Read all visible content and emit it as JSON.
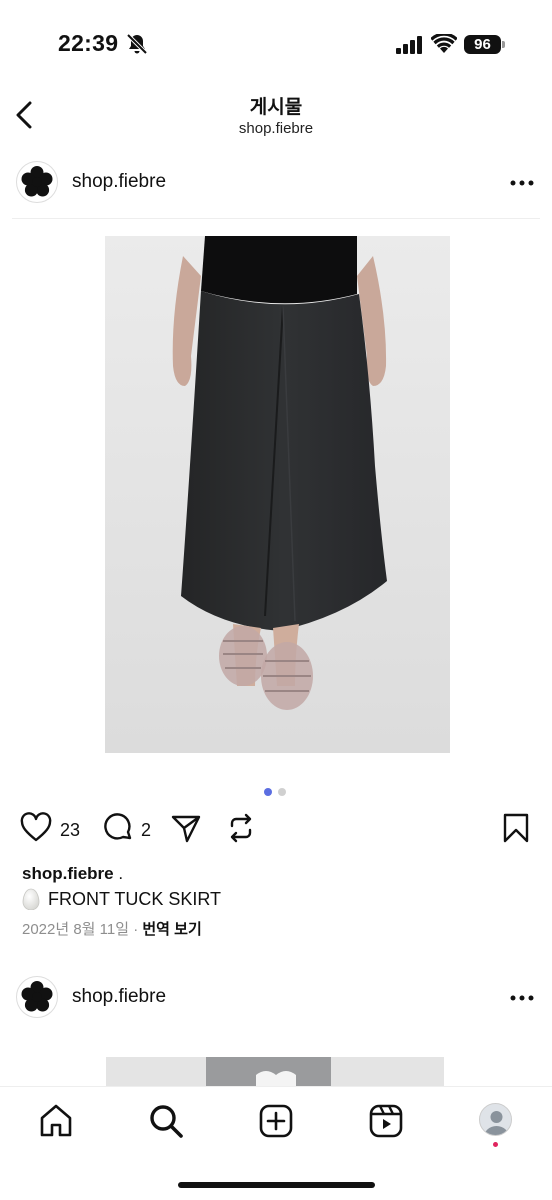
{
  "status_bar": {
    "time": "22:39",
    "battery": "96",
    "icons": [
      "bell-slash-icon",
      "signal-icon",
      "wifi-icon",
      "battery-icon"
    ]
  },
  "header": {
    "title": "게시물",
    "subtitle": "shop.fiebre",
    "back_icon": "chevron-left-icon"
  },
  "posts": [
    {
      "username": "shop.fiebre",
      "avatar_icon": "flower-logo",
      "more_icon": "more-horizontal-icon",
      "carousel": {
        "total": 2,
        "active": 1,
        "active_color": "#5b6ee1",
        "inactive_color": "#d0d0d0"
      },
      "likes": "23",
      "comments": "2",
      "caption_username": "shop.fiebre",
      "caption_suffix": " .",
      "caption_text": "FRONT TUCK SKIRT",
      "caption_emoji": "egg-emoji",
      "date": "2022년 8월 11일",
      "translate": "번역 보기",
      "separator": " · "
    },
    {
      "username": "shop.fiebre",
      "avatar_icon": "flower-logo",
      "more_icon": "more-horizontal-icon"
    }
  ],
  "bottom_nav": {
    "items": [
      "home-icon",
      "search-icon",
      "create-icon",
      "reels-icon",
      "profile-avatar"
    ],
    "badge_color": "#e0245e"
  }
}
